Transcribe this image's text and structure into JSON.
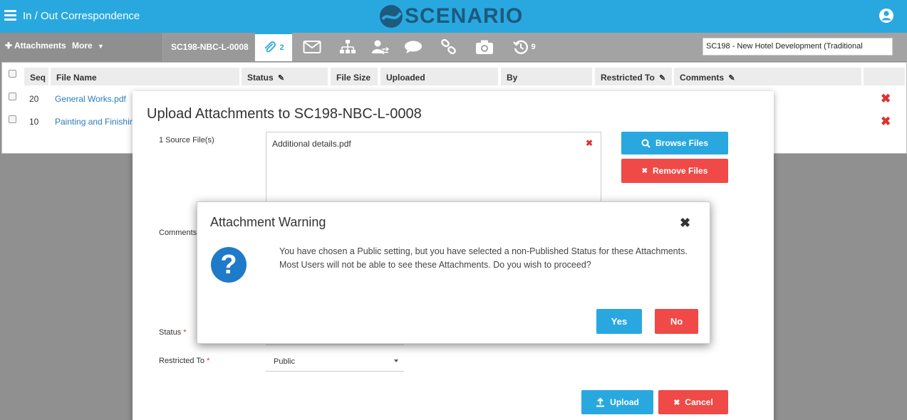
{
  "header": {
    "title": "In / Out Correspondence",
    "brand": "SCENARIO",
    "brand_color": "#1d5a7d",
    "accent_color": "#29a8e0"
  },
  "toolbar": {
    "attachments_label": "Attachments",
    "more_label": "More",
    "reference": "SC198-NBC-L-0008",
    "attachments_count": "2",
    "history_count": "9",
    "project": "SC198  -  New Hotel Development (Traditional"
  },
  "grid": {
    "columns": [
      "Seq",
      "File Name",
      "Status",
      "File Size",
      "Uploaded",
      "By",
      "Restricted To",
      "Comments"
    ],
    "rows": [
      {
        "seq": "20",
        "file": "General Works.pdf"
      },
      {
        "seq": "10",
        "file": "Painting and Finishin"
      }
    ]
  },
  "upload": {
    "title": "Upload Attachments to SC198-NBC-L-0008",
    "source_label": "1 Source File(s)",
    "source_file": "Additional details.pdf",
    "comments_label": "Comments",
    "status_label": "Status",
    "restricted_label": "Restricted To",
    "required_mark": "*",
    "restricted_value": "Public",
    "browse_label": "Browse Files",
    "remove_label": "Remove Files",
    "upload_label": "Upload",
    "cancel_label": "Cancel"
  },
  "warning": {
    "title": "Attachment Warning",
    "message": "You have chosen a Public setting, but you have selected a non-Published Status for these Attachments. Most Users will not be able to see these Attachments. Do you wish to proceed?",
    "yes_label": "Yes",
    "no_label": "No",
    "icon_glyph": "?"
  }
}
